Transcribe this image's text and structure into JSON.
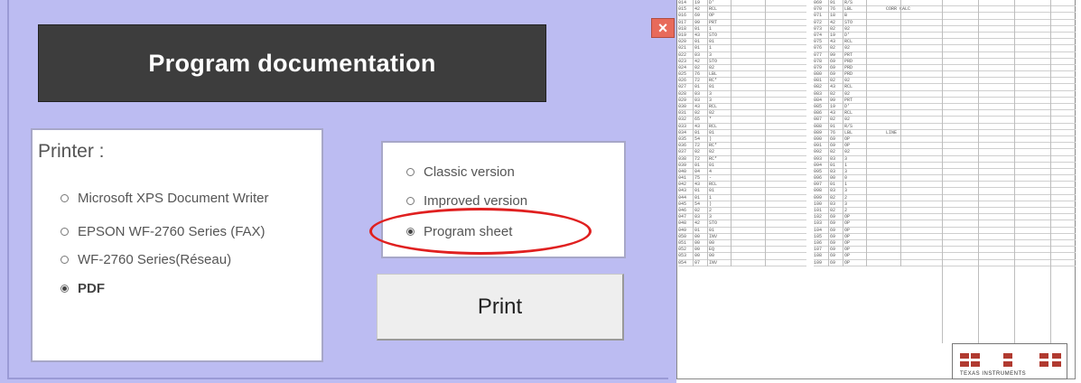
{
  "dialog": {
    "title": "Program documentation",
    "close_glyph": "×",
    "printer_label": "Printer :",
    "printers": [
      {
        "label": "Microsoft XPS Document Writer",
        "selected": false
      },
      {
        "label": "EPSON WF-2760 Series (FAX)",
        "selected": false
      },
      {
        "label": "WF-2760 Series(Réseau)",
        "selected": false
      },
      {
        "label": "PDF",
        "selected": true
      }
    ],
    "versions": [
      {
        "label": "Classic version",
        "selected": false
      },
      {
        "label": "Improved version",
        "selected": false
      },
      {
        "label": "Program sheet",
        "selected": true
      }
    ],
    "print_label": "Print"
  },
  "sheet": {
    "footer_brand": "TEXAS INSTRUMENTS",
    "rows_left": [
      [
        "014",
        "19",
        "D'"
      ],
      [
        "015",
        "42",
        "RCL"
      ],
      [
        "016",
        "69",
        "OP"
      ],
      [
        "017",
        "99",
        "PRT"
      ],
      [
        "018",
        "01",
        "1"
      ],
      [
        "019",
        "43",
        "STO"
      ],
      [
        "020",
        "01",
        "01"
      ],
      [
        "021",
        "01",
        "1"
      ],
      [
        "022",
        "03",
        "3"
      ],
      [
        "023",
        "42",
        "STO"
      ],
      [
        "024",
        "02",
        "02"
      ],
      [
        "025",
        "76",
        "LBL"
      ],
      [
        "026",
        "72",
        "RC*"
      ],
      [
        "027",
        "01",
        "01"
      ],
      [
        "028",
        "03",
        "3"
      ],
      [
        "029",
        "03",
        "3"
      ],
      [
        "030",
        "43",
        "RCL"
      ],
      [
        "031",
        "02",
        "02"
      ],
      [
        "032",
        "65",
        "*"
      ],
      [
        "033",
        "43",
        "RCL"
      ],
      [
        "034",
        "01",
        "01"
      ],
      [
        "035",
        "54",
        ")"
      ],
      [
        "036",
        "72",
        "RC*"
      ],
      [
        "037",
        "02",
        "02"
      ],
      [
        "038",
        "72",
        "RC*"
      ],
      [
        "039",
        "01",
        "01"
      ],
      [
        "040",
        "04",
        "4"
      ],
      [
        "041",
        "75",
        "-"
      ],
      [
        "042",
        "43",
        "RCL"
      ],
      [
        "043",
        "01",
        "01"
      ],
      [
        "044",
        "01",
        "1"
      ],
      [
        "045",
        "54",
        ")"
      ],
      [
        "046",
        "02",
        "2"
      ],
      [
        "047",
        "03",
        "3"
      ],
      [
        "048",
        "42",
        "STO"
      ],
      [
        "049",
        "01",
        "01"
      ],
      [
        "050",
        "00",
        "INV"
      ],
      [
        "051",
        "00",
        "00"
      ],
      [
        "052",
        "00",
        "EQ"
      ],
      [
        "053",
        "00",
        "00"
      ],
      [
        "054",
        "07",
        "INV"
      ]
    ],
    "rows_right": [
      [
        "069",
        "91",
        "R/S"
      ],
      [
        "070",
        "76",
        "LBL"
      ],
      [
        "071",
        "18",
        "B"
      ],
      [
        "072",
        "42",
        "STO"
      ],
      [
        "073",
        "02",
        "02"
      ],
      [
        "074",
        "19",
        "D'"
      ],
      [
        "075",
        "43",
        "RCL"
      ],
      [
        "076",
        "02",
        "02"
      ],
      [
        "077",
        "99",
        "PRT"
      ],
      [
        "078",
        "69",
        "PRD"
      ],
      [
        "079",
        "69",
        "PRD"
      ],
      [
        "080",
        "69",
        "PRD"
      ],
      [
        "081",
        "02",
        "02"
      ],
      [
        "082",
        "43",
        "RCL"
      ],
      [
        "083",
        "02",
        "02"
      ],
      [
        "084",
        "99",
        "PRT"
      ],
      [
        "085",
        "19",
        "D'"
      ],
      [
        "086",
        "43",
        "RCL"
      ],
      [
        "087",
        "02",
        "02"
      ],
      [
        "088",
        "91",
        "R/S"
      ],
      [
        "089",
        "76",
        "LBL"
      ],
      [
        "090",
        "69",
        "OP"
      ],
      [
        "091",
        "69",
        "OP"
      ],
      [
        "092",
        "02",
        "02"
      ],
      [
        "093",
        "03",
        "3"
      ],
      [
        "094",
        "01",
        "1"
      ],
      [
        "095",
        "03",
        "3"
      ],
      [
        "096",
        "00",
        "0"
      ],
      [
        "097",
        "01",
        "1"
      ],
      [
        "098",
        "03",
        "3"
      ],
      [
        "099",
        "02",
        "2"
      ],
      [
        "100",
        "03",
        "3"
      ],
      [
        "101",
        "02",
        "2"
      ],
      [
        "102",
        "69",
        "OP"
      ],
      [
        "103",
        "69",
        "OP"
      ],
      [
        "104",
        "69",
        "OP"
      ],
      [
        "105",
        "69",
        "OP"
      ],
      [
        "106",
        "69",
        "OP"
      ],
      [
        "107",
        "69",
        "OP"
      ],
      [
        "108",
        "69",
        "OP"
      ],
      [
        "109",
        "69",
        "OP"
      ]
    ],
    "notes": {
      "0": "",
      "1": "CORR CALC",
      "20": "LINE"
    }
  },
  "colors": {
    "dialog_bg": "#bcbcf2",
    "title_bg": "#3d3d3d",
    "highlight": "#e02020",
    "ti_red": "#b13a30"
  }
}
